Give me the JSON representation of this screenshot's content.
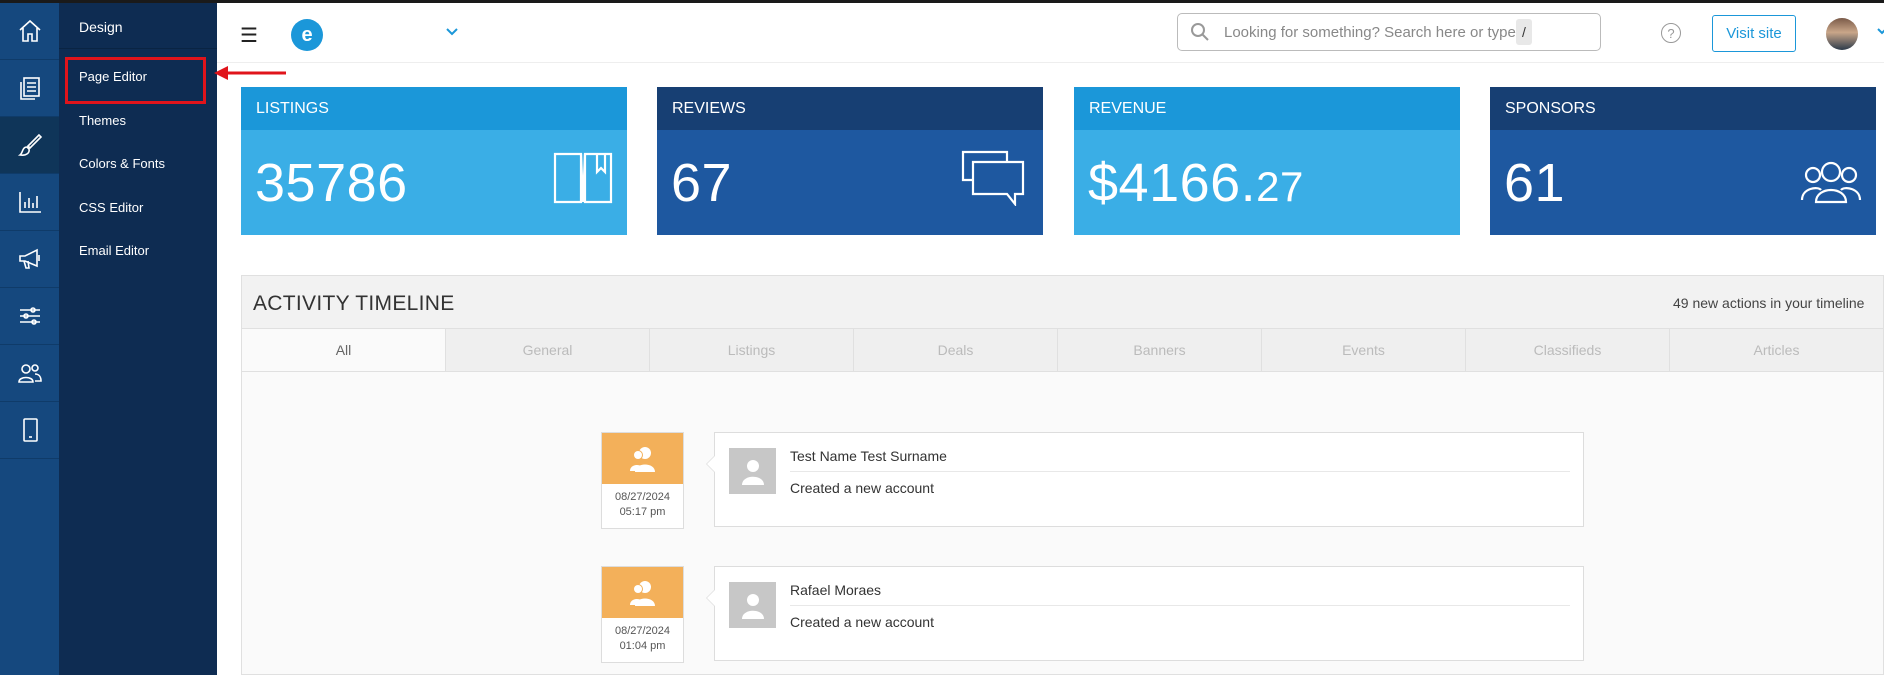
{
  "rail": {
    "items": [
      {
        "icon": "home-icon"
      },
      {
        "icon": "pages-icon"
      },
      {
        "icon": "brush-icon",
        "active": true
      },
      {
        "icon": "chart-icon"
      },
      {
        "icon": "megaphone-icon"
      },
      {
        "icon": "sliders-icon"
      },
      {
        "icon": "users-icon"
      },
      {
        "icon": "mobile-icon"
      }
    ]
  },
  "submenu": {
    "title": "Design",
    "items": [
      "Page Editor",
      "Themes",
      "Colors & Fonts",
      "CSS Editor",
      "Email Editor"
    ]
  },
  "header": {
    "logo_letter": "e",
    "search_placeholder": "Looking for something? Search here or type",
    "search_shortcut": "/",
    "help_label": "?",
    "visit_label": "Visit site"
  },
  "stats": [
    {
      "label": "LISTINGS",
      "value": "35786",
      "cents": "",
      "head_color": "#1b97d9",
      "body_color": "#3aaee6",
      "icon": "book-icon"
    },
    {
      "label": "REVIEWS",
      "value": "67",
      "cents": "",
      "head_color": "#173f73",
      "body_color": "#1e58a0",
      "icon": "chat-bubbles-icon"
    },
    {
      "label": "REVENUE",
      "value": "$4166.",
      "cents": "27",
      "head_color": "#1b97d9",
      "body_color": "#3aaee6",
      "icon": ""
    },
    {
      "label": "SPONSORS",
      "value": "61",
      "cents": "",
      "head_color": "#173f73",
      "body_color": "#1e58a0",
      "icon": "group-icon"
    }
  ],
  "activity": {
    "title": "ACTIVITY TIMELINE",
    "count": "49 new actions in your timeline",
    "tabs": [
      "All",
      "General",
      "Listings",
      "Deals",
      "Banners",
      "Events",
      "Classifieds",
      "Articles"
    ],
    "active_tab": 0,
    "entries": [
      {
        "date": "08/27/2024",
        "time": "05:17 pm",
        "name": "Test Name Test Surname",
        "action": "Created a new account"
      },
      {
        "date": "08/27/2024",
        "time": "01:04 pm",
        "name": "Rafael Moraes",
        "action": "Created a new account"
      }
    ]
  },
  "colors": {
    "rail": "#15487e",
    "submenu": "#0e2c52",
    "accent": "#1b97d9",
    "highlight": "#e0141b",
    "timeline_icon": "#f3b05a"
  }
}
